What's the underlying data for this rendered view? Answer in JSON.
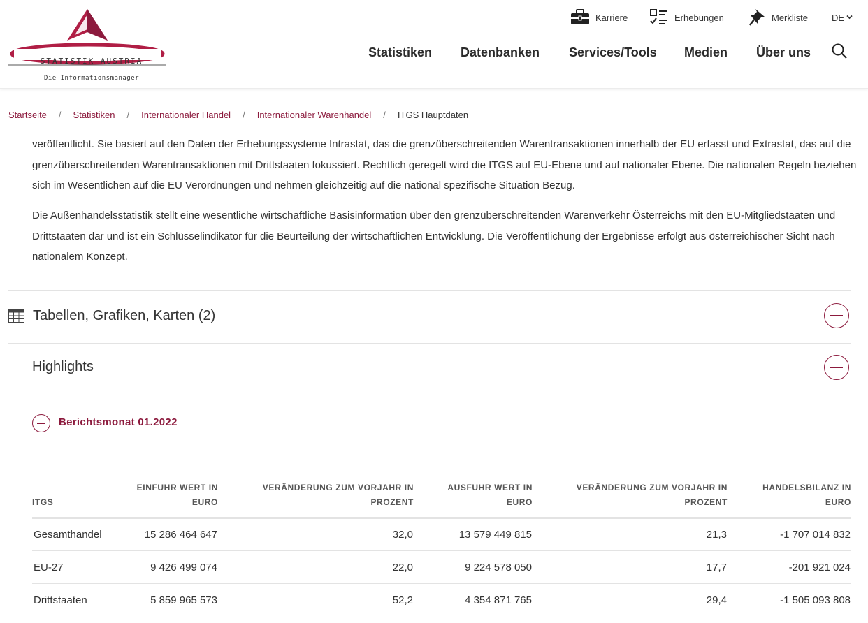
{
  "header": {
    "logo_text": "STATISTIK AUSTRIA",
    "logo_subtext": "Die Informationsmanager",
    "utility": {
      "karriere": "Karriere",
      "erhebungen": "Erhebungen",
      "merkliste": "Merkliste",
      "language": "DE"
    },
    "nav": {
      "statistiken": "Statistiken",
      "datenbanken": "Datenbanken",
      "services": "Services/Tools",
      "medien": "Medien",
      "ueber_uns": "Über uns"
    }
  },
  "breadcrumb": {
    "items": [
      "Startseite",
      "Statistiken",
      "Internationaler Handel",
      "Internationaler Warenhandel"
    ],
    "current": "ITGS Hauptdaten",
    "separator": "/"
  },
  "content": {
    "paragraph1": "veröffentlicht. Sie basiert auf den Daten der Erhebungssysteme Intrastat, das die grenzüberschreitenden Warentransaktionen innerhalb der EU erfasst und Extrastat, das auf die grenzüberschreitenden Warentransaktionen mit Drittstaaten fokussiert. Rechtlich geregelt wird die ITGS auf EU-Ebene und auf nationaler Ebene. Die nationalen Regeln beziehen sich im Wesentlichen auf die EU Verordnungen und nehmen gleichzeitig auf die national spezifische Situation Bezug.",
    "paragraph2": "Die Außenhandelsstatistik stellt eine wesentliche wirtschaftliche Basisinformation über den grenzüberschreitenden Warenverkehr Österreichs mit den EU-Mitgliedstaaten und Drittstaaten dar und ist ein Schlüsselindikator für die Beurteilung der wirtschaftlichen Entwicklung. Die Veröffentlichung der Ergebnisse erfolgt aus österreichischer Sicht nach nationalem Konzept."
  },
  "accordions": {
    "tables": "Tabellen, Grafiken, Karten (2)",
    "highlights": "Highlights",
    "report_month": "Berichtsmonat 01.2022"
  },
  "table": {
    "headers": [
      "ITGS",
      "EINFUHR WERT IN EURO",
      "VERÄNDERUNG ZUM VORJAHR IN PROZENT",
      "AUSFUHR WERT IN EURO",
      "VERÄNDERUNG ZUM VORJAHR IN PROZENT",
      "HANDELSBILANZ IN EURO"
    ],
    "rows": [
      [
        "Gesamthandel",
        "15 286 464 647",
        "32,0",
        "13 579 449 815",
        "21,3",
        "-1 707 014 832"
      ],
      [
        "EU-27",
        "9 426 499 074",
        "22,0",
        "9 224 578 050",
        "17,7",
        "-201 921 024"
      ],
      [
        "Drittstaaten",
        "5 859 965 573",
        "52,2",
        "4 354 871 765",
        "29,4",
        "-1 505 093 808"
      ]
    ]
  },
  "colors": {
    "brand": "#8c1a3d",
    "text": "#333333",
    "divider": "#e3e3e3"
  }
}
